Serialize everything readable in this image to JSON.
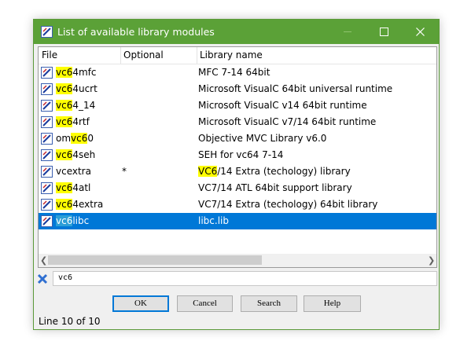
{
  "window": {
    "title": "List of available library modules",
    "title_bar_color": "#5ba137",
    "selection_color": "#0078d7",
    "highlight_color": "#ffff00"
  },
  "columns": [
    "File",
    "Optional",
    "Library name"
  ],
  "rows": [
    {
      "file_pre": "",
      "file_hl": "vc6",
      "file_post": "4mfc",
      "optional": "",
      "lib_pre": "",
      "lib_hl": "",
      "lib_post": "MFC 7-14 64bit",
      "selected": false
    },
    {
      "file_pre": "",
      "file_hl": "vc6",
      "file_post": "4ucrt",
      "optional": "",
      "lib_pre": "",
      "lib_hl": "",
      "lib_post": "Microsoft VisualC 64bit universal runtime",
      "selected": false
    },
    {
      "file_pre": "",
      "file_hl": "vc6",
      "file_post": "4_14",
      "optional": "",
      "lib_pre": "",
      "lib_hl": "",
      "lib_post": "Microsoft VisualC v14 64bit runtime",
      "selected": false
    },
    {
      "file_pre": "",
      "file_hl": "vc6",
      "file_post": "4rtf",
      "optional": "",
      "lib_pre": "",
      "lib_hl": "",
      "lib_post": "Microsoft VisualC v7/14 64bit runtime",
      "selected": false
    },
    {
      "file_pre": "om",
      "file_hl": "vc6",
      "file_post": "0",
      "optional": "",
      "lib_pre": "",
      "lib_hl": "",
      "lib_post": "Objective MVC Library v6.0",
      "selected": false
    },
    {
      "file_pre": "",
      "file_hl": "vc6",
      "file_post": "4seh",
      "optional": "",
      "lib_pre": "",
      "lib_hl": "",
      "lib_post": "SEH for vc64 7-14",
      "selected": false
    },
    {
      "file_pre": "vcextra",
      "file_hl": "",
      "file_post": "",
      "optional": "*",
      "lib_pre": "",
      "lib_hl": "VC6",
      "lib_post": "/14 Extra (techology) library",
      "selected": false
    },
    {
      "file_pre": "",
      "file_hl": "vc6",
      "file_post": "4atl",
      "optional": "",
      "lib_pre": "",
      "lib_hl": "",
      "lib_post": "VC7/14 ATL 64bit support library",
      "selected": false
    },
    {
      "file_pre": "",
      "file_hl": "vc6",
      "file_post": "4extra",
      "optional": "",
      "lib_pre": "",
      "lib_hl": "",
      "lib_post": "VC7/14 Extra (techology) 64bit library",
      "selected": false
    },
    {
      "file_pre": "",
      "file_hl": "vc6",
      "file_post": "libc",
      "optional": "",
      "lib_pre": "",
      "lib_hl": "",
      "lib_post": "libc.lib",
      "selected": true
    }
  ],
  "filter": {
    "value": "vc6",
    "icon": "clear-filter-icon"
  },
  "buttons": {
    "ok": "OK",
    "cancel": "Cancel",
    "search": "Search",
    "help": "Help"
  },
  "status": "Line 10 of 10",
  "icons": {
    "row": "library-module-icon",
    "title": "app-icon",
    "close": "close-icon",
    "maximize": "maximize-icon",
    "minimize": "minimize-icon"
  }
}
